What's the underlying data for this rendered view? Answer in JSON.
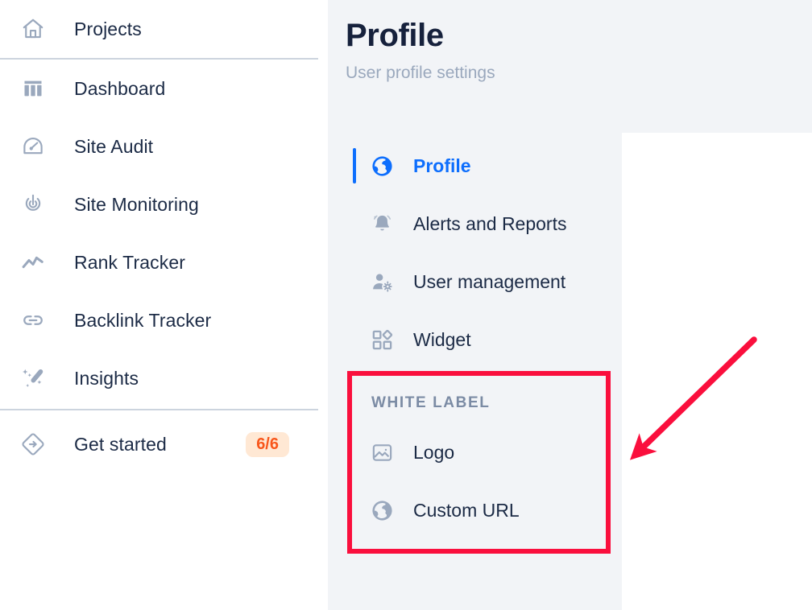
{
  "sidebar": {
    "top_items": [
      {
        "label": "Projects",
        "icon": "home-icon"
      }
    ],
    "main_items": [
      {
        "label": "Dashboard",
        "icon": "dashboard-icon"
      },
      {
        "label": "Site Audit",
        "icon": "gauge-icon"
      },
      {
        "label": "Site Monitoring",
        "icon": "radar-icon"
      },
      {
        "label": "Rank Tracker",
        "icon": "line-chart-icon"
      },
      {
        "label": "Backlink Tracker",
        "icon": "link-icon"
      },
      {
        "label": "Insights",
        "icon": "magic-wand-icon"
      }
    ],
    "bottom_items": [
      {
        "label": "Get started",
        "icon": "diamond-arrow-icon",
        "badge": "6/6"
      }
    ]
  },
  "header": {
    "title": "Profile",
    "subtitle": "User profile settings"
  },
  "settings_nav": {
    "items": [
      {
        "label": "Profile",
        "icon": "globe-icon",
        "active": true
      },
      {
        "label": "Alerts and Reports",
        "icon": "bell-icon",
        "active": false
      },
      {
        "label": "User management",
        "icon": "user-gear-icon",
        "active": false
      },
      {
        "label": "Widget",
        "icon": "widget-grid-icon",
        "active": false
      }
    ],
    "white_label": {
      "title": "WHITE LABEL",
      "items": [
        {
          "label": "Logo",
          "icon": "image-icon"
        },
        {
          "label": "Custom URL",
          "icon": "globe-icon"
        }
      ]
    }
  },
  "colors": {
    "accent_blue": "#0d6efd",
    "badge_text": "#f8561b",
    "badge_bg": "#ffe8d4",
    "annotation_red": "#fa0f3d",
    "text_dark": "#1b2a45",
    "text_muted": "#9aa8bd",
    "panel_bg": "#f2f4f7"
  }
}
